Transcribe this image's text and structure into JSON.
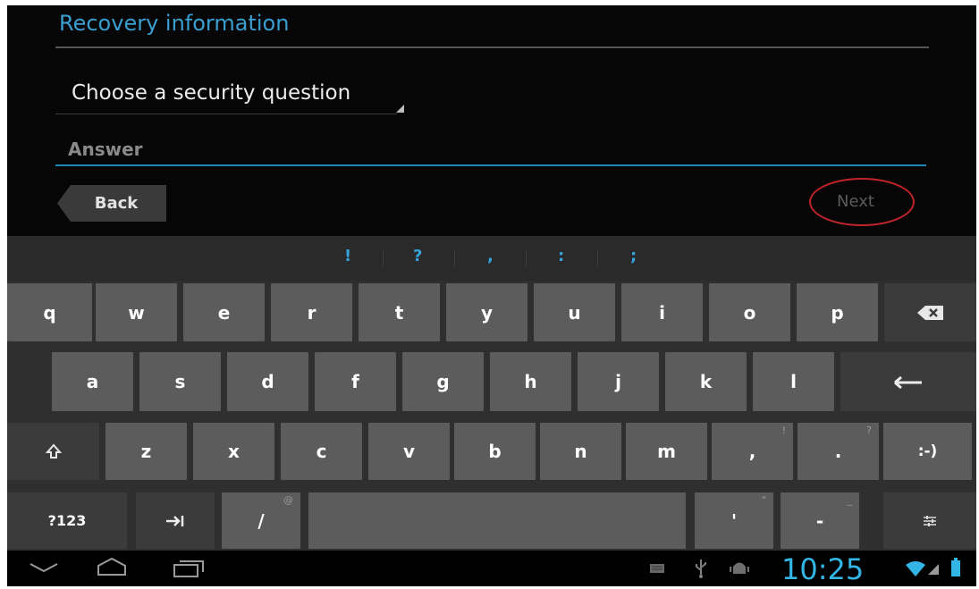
{
  "form": {
    "section_title": "Recovery information",
    "question_spinner": "Choose a security question",
    "answer_placeholder": "Answer",
    "back_label": "Back",
    "next_label": "Next"
  },
  "keyboard": {
    "suggestions": [
      "!",
      "?",
      ",",
      ":",
      ";"
    ],
    "row1": [
      "q",
      "w",
      "e",
      "r",
      "t",
      "y",
      "u",
      "i",
      "o",
      "p"
    ],
    "row2": [
      "a",
      "s",
      "d",
      "f",
      "g",
      "h",
      "j",
      "k",
      "l"
    ],
    "row3": [
      "z",
      "x",
      "c",
      "v",
      "b",
      "n",
      "m"
    ],
    "comma": {
      "label": ",",
      "sup": "!"
    },
    "period": {
      "label": ".",
      "sup": "?"
    },
    "smiley": ":-)",
    "symbols": "?123",
    "slash": {
      "label": "/",
      "sup": "@"
    },
    "apostrophe": {
      "label": "'",
      "sup": "\""
    },
    "hyphen": {
      "label": "-",
      "sup": "_"
    },
    "icons": {
      "backspace": "backspace-icon",
      "enter": "enter-icon",
      "shift": "shift-icon",
      "tab": "tab-icon",
      "settings": "keyboard-settings-icon"
    }
  },
  "navbar": {
    "time": "10:25",
    "icons": [
      "back-nav-icon",
      "home-nav-icon",
      "recent-apps-icon",
      "keyboard-status-icon",
      "usb-icon",
      "android-debug-icon",
      "wifi-icon",
      "signal-icon",
      "battery-icon"
    ]
  },
  "colors": {
    "accent": "#33b5e5",
    "annotation_circle": "#c0242b"
  }
}
